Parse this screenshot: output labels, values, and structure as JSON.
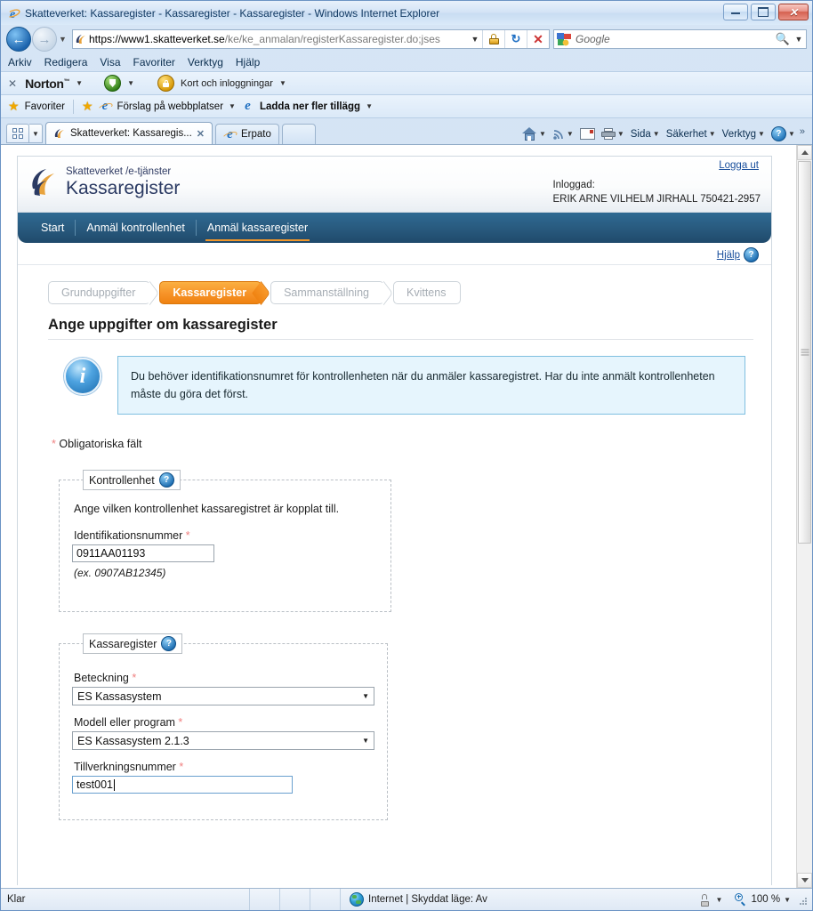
{
  "window": {
    "title": "Skatteverket: Kassaregister - Kassaregister - Kassaregister - Windows Internet Explorer",
    "minimize_label": "",
    "maximize_label": "",
    "close_label": "✕"
  },
  "address": {
    "url_secure": "https://www1.skatteverket.se",
    "url_path": "/ke/ke_anmalan/registerKassaregister.do;jses",
    "dropdown_caret": "▼"
  },
  "search": {
    "placeholder": "Google",
    "caret": "▼"
  },
  "menubar": {
    "items": [
      {
        "label": "Arkiv",
        "accel": "A"
      },
      {
        "label": "Redigera",
        "accel": "R"
      },
      {
        "label": "Visa",
        "accel": "i"
      },
      {
        "label": "Favoriter",
        "accel": "F"
      },
      {
        "label": "Verktyg",
        "accel": "y"
      },
      {
        "label": "Hjälp",
        "accel": "H"
      }
    ]
  },
  "norton_bar": {
    "close_label": "✕",
    "brand": "Norton",
    "brand_tm": "™",
    "caret": "▼",
    "cards_label": "Kort och inloggningar"
  },
  "favorites_bar": {
    "favorites_label": "Favoriter",
    "suggested_sites_label": "Förslag på webbplatser",
    "more_addons_label": "Ladda ner fler tillägg",
    "caret": "▼"
  },
  "tabs": {
    "quick_tabs_caret": "▼",
    "items": [
      {
        "title": "Skatteverket: Kassaregis...",
        "close": "✕",
        "active": true
      },
      {
        "title": "Erpato",
        "close": "",
        "active": false
      }
    ]
  },
  "command_bar": {
    "home_caret": "▼",
    "feeds_caret": "▼",
    "print_caret": "▼",
    "page_label": "Sida",
    "safety_label": "Säkerhet",
    "tools_label": "Verktyg",
    "help_caret": "▼",
    "overflow": "»"
  },
  "site": {
    "brand_small": "Skatteverket /e-tjänster",
    "brand_big": "Kassaregister",
    "logged_in_label": "Inloggad:",
    "logged_in_user": "ERIK ARNE VILHELM JIRHALL 750421-2957",
    "logout_label": "Logga ut",
    "nav": [
      {
        "label": "Start",
        "active": false
      },
      {
        "label": "Anmäl kontrollenhet",
        "active": false
      },
      {
        "label": "Anmäl kassaregister",
        "active": true
      }
    ],
    "help_label": "Hjälp",
    "help_icon": "?"
  },
  "steps": [
    {
      "label": "Grunduppgifter",
      "state": "done"
    },
    {
      "label": "Kassaregister",
      "state": "current"
    },
    {
      "label": "Sammanställning",
      "state": "upcoming"
    },
    {
      "label": "Kvittens",
      "state": "upcoming"
    }
  ],
  "page": {
    "title": "Ange uppgifter om kassaregister",
    "info_icon": "i",
    "info_text": "Du behöver identifikationsnumret för kontrollenheten när du anmäler kassaregistret. Har du inte anmält kontrollenheten måste du göra det först.",
    "required_asterisk": "*",
    "required_note": "Obligatoriska fält"
  },
  "fieldset_kontrollenhet": {
    "legend": "Kontrollenhet",
    "legend_help_icon": "?",
    "description": "Ange vilken kontrollenhet kassaregistret är kopplat till.",
    "id_label": "Identifikationsnummer",
    "id_asterisk": "*",
    "id_value": "0911AA01193",
    "id_example": "(ex. 0907AB12345)"
  },
  "fieldset_kassaregister": {
    "legend": "Kassaregister",
    "legend_help_icon": "?",
    "beteckning_label": "Beteckning",
    "beteckning_asterisk": "*",
    "beteckning_value": "ES Kassasystem",
    "modell_label": "Modell eller program",
    "modell_asterisk": "*",
    "modell_value": "ES Kassasystem 2.1.3",
    "tillverkning_label": "Tillverkningsnummer",
    "tillverkning_asterisk": "*",
    "tillverkning_value": "test001",
    "select_caret": "▼"
  },
  "statusbar": {
    "status_text": "Klar",
    "zone_text": "Internet | Skyddat läge: Av",
    "zoom_level": "100 %",
    "caret": "▼"
  },
  "colors": {
    "accent_orange": "#f0962a",
    "nav_blue": "#28597d",
    "info_bg": "#e6f5fd",
    "info_border": "#7fbfe0",
    "link_blue": "#1a4f9c",
    "required_red": "#f08080"
  }
}
